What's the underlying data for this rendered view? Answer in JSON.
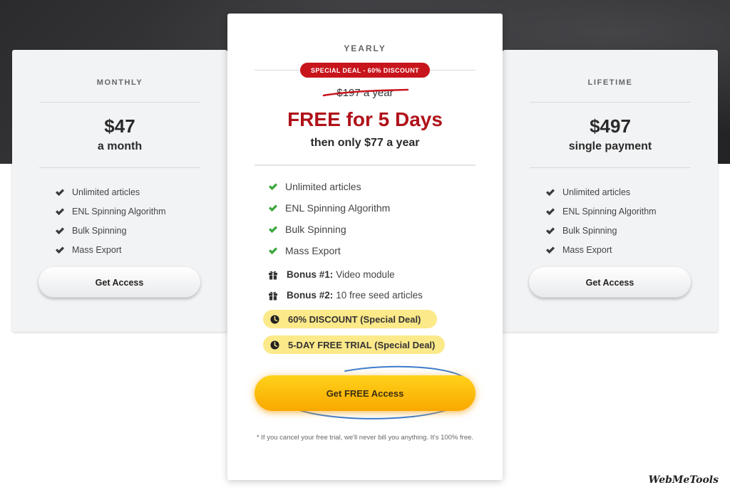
{
  "monthly": {
    "plan_name": "MONTHLY",
    "price": "$47",
    "period": "a month",
    "features": [
      "Unlimited articles",
      "ENL Spinning Algorithm",
      "Bulk Spinning",
      "Mass Export"
    ],
    "cta_label": "Get Access"
  },
  "yearly": {
    "plan_name": "YEARLY",
    "deal_badge": "SPECIAL DEAL - 60% DISCOUNT",
    "old_price": "$197 a year",
    "headline": "FREE for 5 Days",
    "subline": "then only $77 a year",
    "features": [
      "Unlimited articles",
      "ENL Spinning Algorithm",
      "Bulk Spinning",
      "Mass Export"
    ],
    "bonuses": [
      {
        "title": "Bonus #1:",
        "text": "Video module"
      },
      {
        "title": "Bonus #2:",
        "text": "10 free seed articles"
      }
    ],
    "highlights": [
      "60% DISCOUNT (Special Deal)",
      "5-DAY FREE TRIAL (Special Deal)"
    ],
    "cta_label": "Get FREE Access",
    "footnote": "* If you cancel your free trial, we'll never bill you anything. It's 100% free."
  },
  "lifetime": {
    "plan_name": "LIFETIME",
    "price": "$497",
    "period": "single payment",
    "features": [
      "Unlimited articles",
      "ENL Spinning Algorithm",
      "Bulk Spinning",
      "Mass Export"
    ],
    "cta_label": "Get Access"
  },
  "watermark": "WebMeTools",
  "colors": {
    "accent_red": "#b0121a",
    "badge_red": "#c8141b",
    "check_green": "#3aa63c",
    "highlight_yellow": "#fce98a",
    "cta_yellow": "#ffc400",
    "scribble_blue": "#3b7bd1"
  },
  "icons": {
    "feature": "check-icon",
    "bonus": "gift-icon",
    "highlight": "clock-icon"
  }
}
